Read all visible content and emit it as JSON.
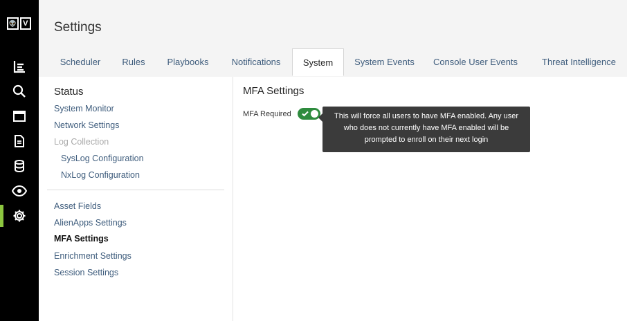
{
  "rail": {
    "logo_letters": [
      "👽",
      "V"
    ],
    "items": [
      {
        "name": "dashboard-icon"
      },
      {
        "name": "search-icon"
      },
      {
        "name": "window-icon"
      },
      {
        "name": "document-icon"
      },
      {
        "name": "database-icon"
      },
      {
        "name": "eye-icon"
      },
      {
        "name": "gear-icon",
        "active": true
      }
    ],
    "active_color": "#8cc63f"
  },
  "header": {
    "title": "Settings"
  },
  "tabs": [
    {
      "label": "Scheduler"
    },
    {
      "label": "Rules"
    },
    {
      "label": "Playbooks"
    },
    {
      "label": "Notifications"
    },
    {
      "label": "System",
      "active": true
    },
    {
      "label": "System Events"
    },
    {
      "label": "Console User Events"
    },
    {
      "label": "Threat Intelligence"
    }
  ],
  "sidebar": {
    "heading": "Status",
    "group1": [
      "System Monitor",
      "Network Settings",
      "Log Collection",
      "SysLog Configuration",
      "NxLog Configuration"
    ],
    "group2": [
      "Asset Fields",
      "AlienApps Settings",
      "MFA Settings",
      "Enrichment Settings",
      "Session Settings"
    ]
  },
  "main": {
    "title": "MFA Settings",
    "mfa_label": "MFA Required",
    "toggle_on": true,
    "toggle_color": "#2e8b3e",
    "tooltip_lines": [
      "This will force all users to have MFA enabled. Any user",
      "who does not currently have MFA enabled will be",
      "prompted to enroll on their next login"
    ]
  }
}
